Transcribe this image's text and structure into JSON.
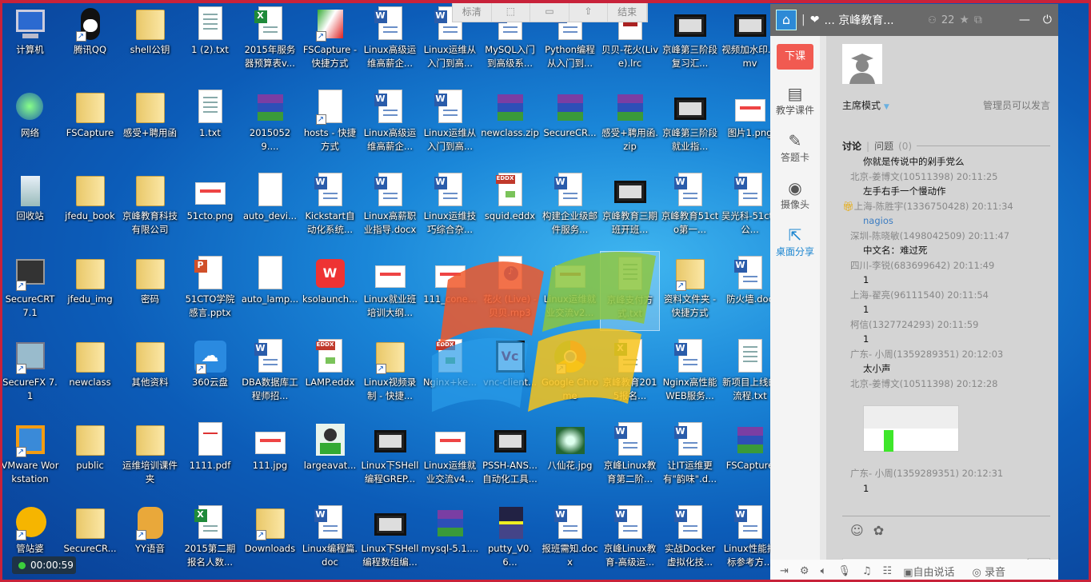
{
  "toolbar": {
    "items": [
      "标清",
      "select-region-icon",
      "window-icon",
      "share-icon",
      "结束"
    ]
  },
  "timer": "00:00:59",
  "desktop": [
    [
      {
        "l": "计算机",
        "t": "computer"
      },
      {
        "l": "腾讯QQ",
        "t": "qq",
        "s": 1
      },
      {
        "l": "shell公钥",
        "t": "folder"
      },
      {
        "l": "1 (2).txt",
        "t": "txt"
      },
      {
        "l": "2015年服务器预算表v...",
        "t": "excel"
      },
      {
        "l": "FSCapture - 快捷方式",
        "t": "fscapture",
        "s": 1
      },
      {
        "l": "Linux高级运维高薪企...",
        "t": "word"
      },
      {
        "l": "Linux运维从入门到高...",
        "t": "word"
      },
      {
        "l": "MySQL入门到高级系...",
        "t": "word"
      },
      {
        "l": "Python编程从入门到...",
        "t": "word"
      },
      {
        "l": "贝贝-花火(Live).lrc",
        "t": "lrc"
      },
      {
        "l": "京峰第三阶段复习汇...",
        "t": "video"
      },
      {
        "l": "视频加水印.wmv",
        "t": "video"
      }
    ],
    [
      {
        "l": "网络",
        "t": "network"
      },
      {
        "l": "FSCapture",
        "t": "folder"
      },
      {
        "l": "感受+聘用函",
        "t": "folder"
      },
      {
        "l": "1.txt",
        "t": "txt"
      },
      {
        "l": "20150529....",
        "t": "rar"
      },
      {
        "l": "hosts - 快捷方式",
        "t": "file",
        "s": 1
      },
      {
        "l": "Linux高级运维高薪企...",
        "t": "word"
      },
      {
        "l": "Linux运维从入门到高...",
        "t": "word"
      },
      {
        "l": "newclass.zip",
        "t": "rar"
      },
      {
        "l": "SecureCR...",
        "t": "rar"
      },
      {
        "l": "感受+聘用函.zip",
        "t": "rar"
      },
      {
        "l": "京峰第三阶段就业指...",
        "t": "video"
      },
      {
        "l": "图片1.png",
        "t": "image"
      }
    ],
    [
      {
        "l": "回收站",
        "t": "recycle"
      },
      {
        "l": "jfedu_book",
        "t": "folder"
      },
      {
        "l": "京峰教育科技有限公司",
        "t": "folder"
      },
      {
        "l": "51cto.png",
        "t": "image"
      },
      {
        "l": "auto_devi...",
        "t": "file"
      },
      {
        "l": "Kickstart自动化系统...",
        "t": "word"
      },
      {
        "l": "Linux高薪职业指导.docx",
        "t": "word"
      },
      {
        "l": "Linux运维技巧综合杂...",
        "t": "word"
      },
      {
        "l": "squid.eddx",
        "t": "eddx"
      },
      {
        "l": "构建企业级邮件服务...",
        "t": "word"
      },
      {
        "l": "京峰教育三期班开班...",
        "t": "video"
      },
      {
        "l": "京峰教育51cto第一...",
        "t": "word"
      },
      {
        "l": "吴光科-51cto公...",
        "t": "word"
      }
    ],
    [
      {
        "l": "SecureCRT 7.1",
        "t": "securecrt",
        "s": 1
      },
      {
        "l": "jfedu_img",
        "t": "folder"
      },
      {
        "l": "密码",
        "t": "folder"
      },
      {
        "l": "51CTO学院感言.pptx",
        "t": "ppt"
      },
      {
        "l": "auto_lamp...",
        "t": "file"
      },
      {
        "l": "ksolaunch...",
        "t": "wps"
      },
      {
        "l": "Linux就业班培训大纲...",
        "t": "image"
      },
      {
        "l": "111_cone...",
        "t": "image"
      },
      {
        "l": "花火 (Live) - 贝贝.mp3",
        "t": "audio"
      },
      {
        "l": "Linux运维就业交流v2...",
        "t": "image"
      },
      {
        "l": "京峰支付方式.txt",
        "t": "txt",
        "sel": 1
      },
      {
        "l": "资料文件夹 - 快捷方式",
        "t": "folder",
        "s": 1
      },
      {
        "l": "防火墙.doc",
        "t": "word"
      }
    ],
    [
      {
        "l": "SecureFX 7.1",
        "t": "securefx",
        "s": 1
      },
      {
        "l": "newclass",
        "t": "folder"
      },
      {
        "l": "其他资料",
        "t": "folder"
      },
      {
        "l": "360云盘",
        "t": "cloud",
        "s": 1
      },
      {
        "l": "DBA数据库工程师招...",
        "t": "word"
      },
      {
        "l": "LAMP.eddx",
        "t": "eddx"
      },
      {
        "l": "Linux视频录制 - 快捷...",
        "t": "folder",
        "s": 1
      },
      {
        "l": "Nginx+ke...",
        "t": "eddx"
      },
      {
        "l": "vnc-client...",
        "t": "vnc"
      },
      {
        "l": "Google Chrome",
        "t": "chrome",
        "s": 1
      },
      {
        "l": "京峰教育2015报名...",
        "t": "excel"
      },
      {
        "l": "Nginx高性能WEB服务...",
        "t": "word"
      },
      {
        "l": "新项目上线的流程.txt",
        "t": "txt"
      }
    ],
    [
      {
        "l": "VMware Workstation",
        "t": "vmware",
        "s": 1
      },
      {
        "l": "public",
        "t": "folder"
      },
      {
        "l": "运维培训课件夹",
        "t": "folder"
      },
      {
        "l": "1111.pdf",
        "t": "pdf"
      },
      {
        "l": "111.jpg",
        "t": "image"
      },
      {
        "l": "largeavat...",
        "t": "avatar"
      },
      {
        "l": "Linux下SHell编程GREP...",
        "t": "video"
      },
      {
        "l": "Linux运维就业交流v4...",
        "t": "image"
      },
      {
        "l": "PSSH-ANS...自动化工具...",
        "t": "video"
      },
      {
        "l": "八仙花.jpg",
        "t": "photo"
      },
      {
        "l": "京峰Linux教育第二阶...",
        "t": "word"
      },
      {
        "l": "让IT运维更有\"韵味\".d...",
        "t": "word"
      },
      {
        "l": "FSCapture",
        "t": "rar"
      }
    ],
    [
      {
        "l": "管站婆",
        "t": "smile",
        "s": 1
      },
      {
        "l": "SecureCR...",
        "t": "folder"
      },
      {
        "l": "YY语音",
        "t": "yy",
        "s": 1
      },
      {
        "l": "2015第二期报名人数...",
        "t": "excel"
      },
      {
        "l": "Downloads",
        "t": "folder",
        "s": 1
      },
      {
        "l": "Linux编程篇.doc",
        "t": "word"
      },
      {
        "l": "Linux下SHell编程数组编...",
        "t": "video"
      },
      {
        "l": "mysql-5.1....",
        "t": "rar"
      },
      {
        "l": "putty_V0.6...",
        "t": "putty"
      },
      {
        "l": "报班需知.docx",
        "t": "word"
      },
      {
        "l": "京峰Linux教育-高级运...",
        "t": "word"
      },
      {
        "l": "实战Docker虚拟化技...",
        "t": "word"
      },
      {
        "l": "Linux性能指标参考方...",
        "t": "word"
      }
    ]
  ],
  "panel": {
    "title": "... 京峰教育...",
    "members": "22",
    "end_class": "下课",
    "nav": [
      {
        "label": "教学课件",
        "icon": "courseware-icon",
        "g": "▤"
      },
      {
        "label": "答题卡",
        "icon": "answer-card-icon",
        "g": "✎"
      },
      {
        "label": "摄像头",
        "icon": "camera-icon",
        "g": "◉"
      },
      {
        "label": "桌面分享",
        "icon": "desktop-share-icon",
        "g": "⇱",
        "active": true
      }
    ],
    "mode": "主席模式",
    "mode_note": "管理员可以发言",
    "tab_discuss": "讨论",
    "tab_questions": "问题",
    "question_count": "(0)",
    "messages": [
      {
        "text": "你就是传说中的剁手党么",
        "meta": "北京-姜博文(10511398) 20:11:25"
      },
      {
        "text": "左手右手一个慢动作",
        "meta": "上海-陈胜宇(1336750428) 20:11:34",
        "gift": true
      },
      {
        "text": "nagios",
        "blue": true,
        "meta": "深圳-陈晓敏(1498042509) 20:11:47"
      },
      {
        "text": "中文名：难过死",
        "meta": "四川-李锐(683699642) 20:11:49"
      },
      {
        "text": "1",
        "meta": "上海-翟亮(96111540) 20:11:54"
      },
      {
        "text": "1",
        "meta": "柯信(1327724293) 20:11:59"
      },
      {
        "text": "1",
        "meta": "广东- 小周(1359289351) 20:12:03"
      },
      {
        "text": "太小声",
        "meta": "北京-姜博文(10511398) 20:12:28"
      },
      {
        "image": true,
        "meta": "广东- 小周(1359289351) 20:12:31"
      },
      {
        "text": "1"
      }
    ],
    "bottom": {
      "free_talk": "自由说话",
      "record": "录音"
    }
  }
}
